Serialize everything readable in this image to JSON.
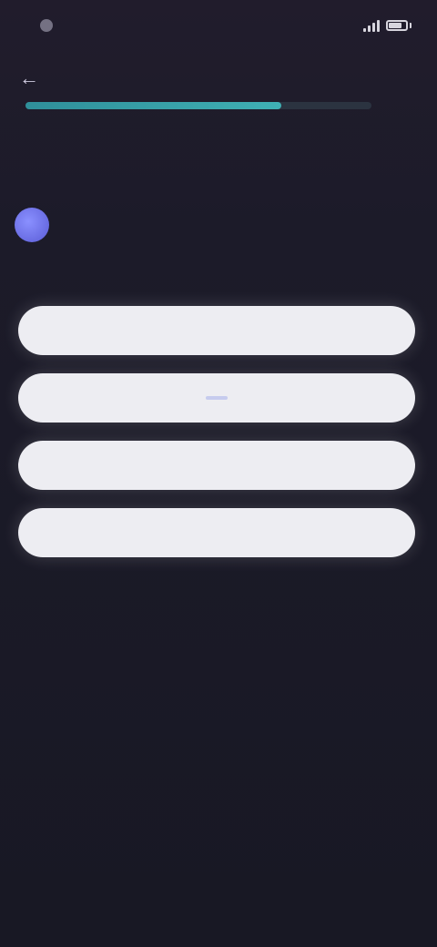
{
  "status_bar": {
    "time": "",
    "icons": [
      "notification-dot-icon",
      "signal-icon",
      "battery-icon"
    ]
  },
  "header": {
    "title": "",
    "back_icon": "arrow-left-icon",
    "progress": 0.74
  },
  "question": {
    "text": ""
  },
  "info": {
    "icon": "info-icon",
    "icon_glyph": "",
    "text": "",
    "link_text": ""
  },
  "options": [
    {
      "label": "",
      "selected": false
    },
    {
      "label": "",
      "selected": true
    },
    {
      "label": "",
      "selected": false
    },
    {
      "label": "",
      "selected": false
    }
  ],
  "colors": {
    "background": "#1a1a26",
    "accent": "#3fb0b4",
    "option_bg": "#ededf2",
    "info_icon": "#6c70e8"
  }
}
